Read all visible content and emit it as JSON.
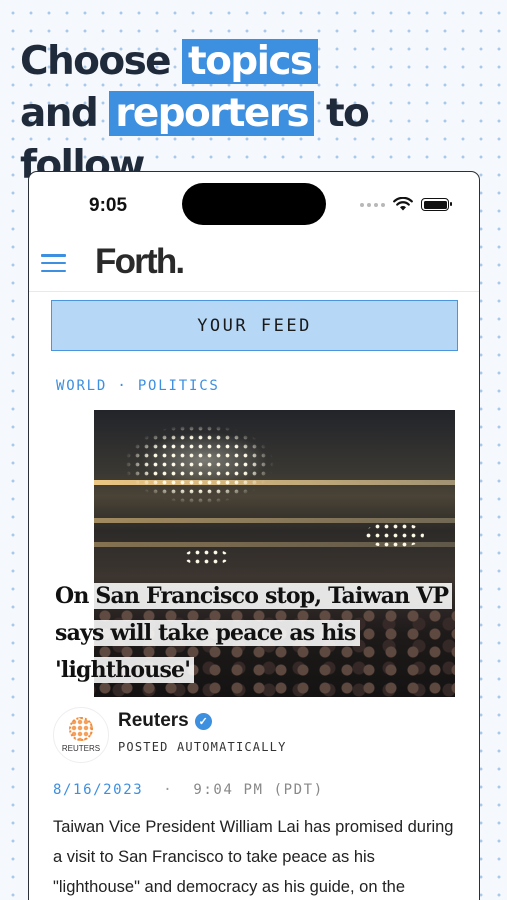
{
  "promo": {
    "line1_prefix": "Choose",
    "line1_highlight": "topics",
    "line2_highlight": "reporters",
    "line2_prefix": "and",
    "line2_suffix": "to follow",
    "accent_color": "#3d8fe0"
  },
  "status_bar": {
    "time": "9:05",
    "icons": [
      "signal-dots-icon",
      "wifi-icon",
      "battery-icon"
    ]
  },
  "app": {
    "logo": "Forth.",
    "menu_icon": "hamburger-menu-icon"
  },
  "feed_button": {
    "label": "YOUR FEED"
  },
  "article": {
    "category": "WORLD · POLITICS",
    "title": "On San Francisco stop, Taiwan VP says will take peace as his 'lighthouse'",
    "source": {
      "name": "Reuters",
      "logo_text": "REUTERS",
      "verified": true,
      "subtitle": "POSTED AUTOMATICALLY"
    },
    "date": "8/16/2023",
    "separator": "·",
    "time": "9:04 PM (PDT)",
    "body": "Taiwan Vice President William Lai has promised during a visit to San Francisco to take peace as his \"lighthouse\" and democracy as his guide, on the"
  }
}
